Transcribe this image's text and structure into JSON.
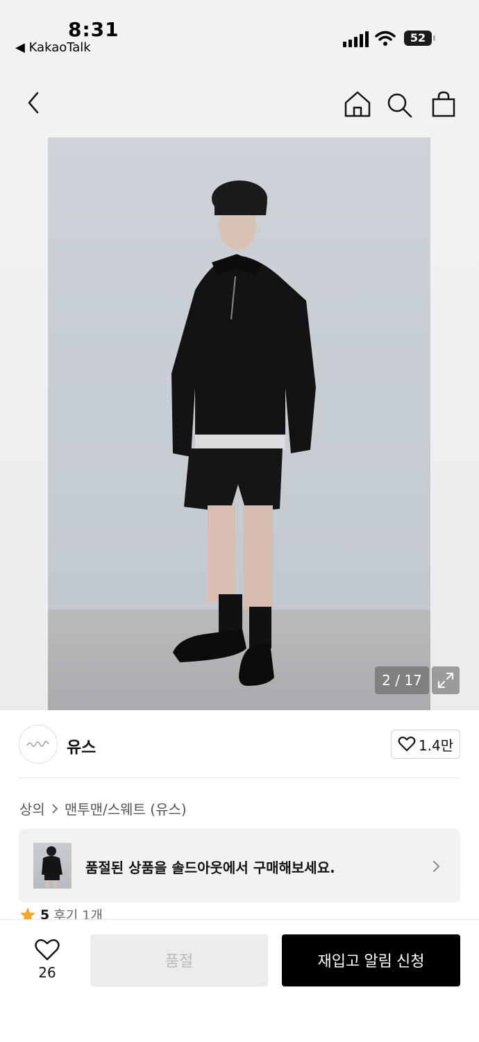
{
  "status_bar": {
    "time": "8:31",
    "back_app": "◀ KakaoTalk",
    "battery": "52"
  },
  "nav": {
    "back_icon": "chevron-left-icon",
    "home_icon": "home-icon",
    "search_icon": "search-icon",
    "bag_icon": "shopping-bag-icon"
  },
  "gallery": {
    "counter": "2 / 17"
  },
  "brand": {
    "name": "유스",
    "like_count": "1.4만"
  },
  "breadcrumb": {
    "category": "상의",
    "subcategory": "맨투맨/스웨트 (유스)"
  },
  "soldout_banner": {
    "text": "품절된 상품을 솔드아웃에서 구매해보세요."
  },
  "rating": {
    "score": "5",
    "reviews": "후기 1개"
  },
  "bottom_bar": {
    "wish_count": "26",
    "soldout_label": "품절",
    "restock_label": "재입고 알림 신청"
  },
  "colors": {
    "primary_button": "#000000",
    "disabled_button": "#ececec",
    "star": "#f5a623"
  }
}
